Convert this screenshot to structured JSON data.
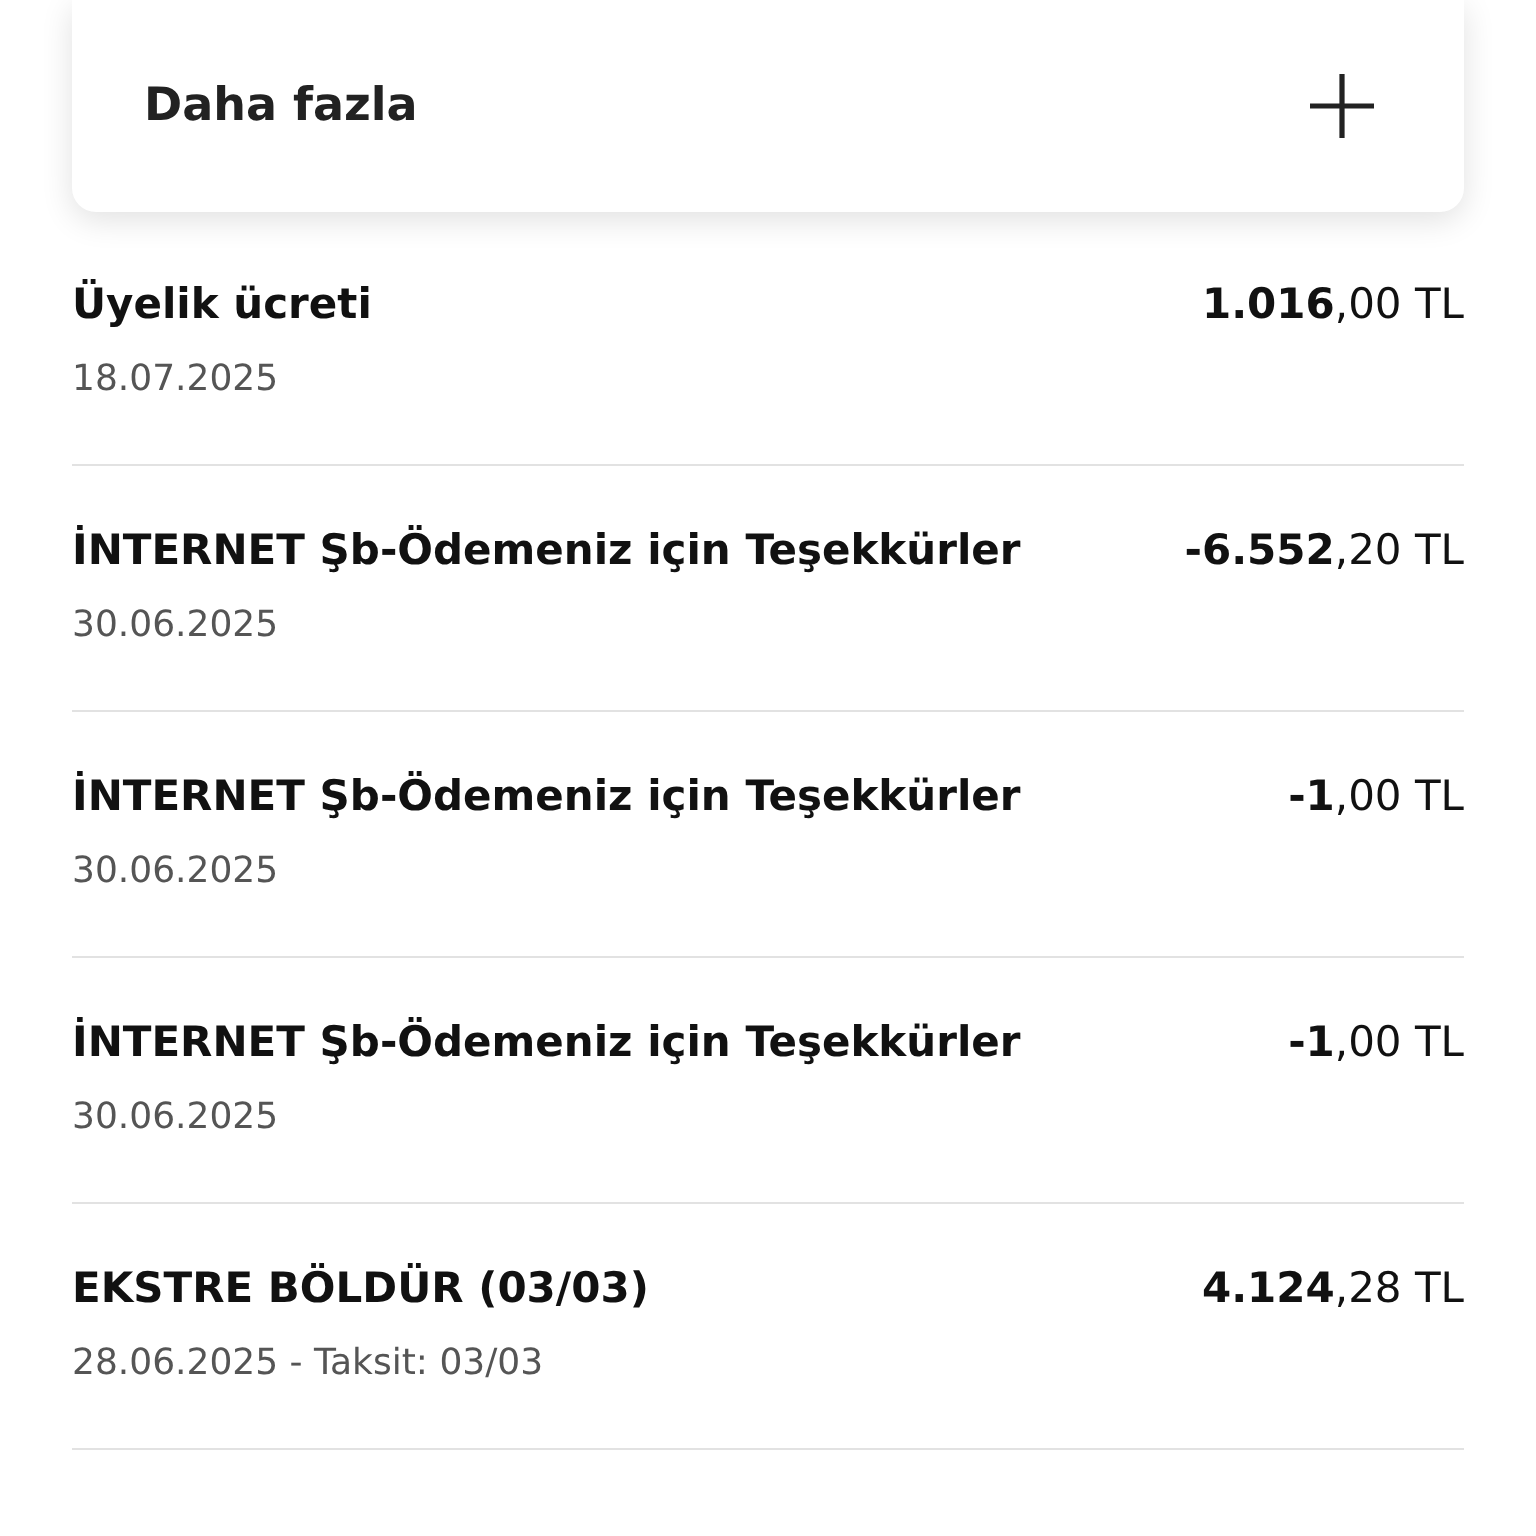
{
  "more_card": {
    "label": "Daha fazla"
  },
  "transactions": [
    {
      "title": "Üyelik ücreti",
      "date": "18.07.2025",
      "amount": "**1.016**,00 TL"
    },
    {
      "title": "İNTERNET Şb-Ödemeniz için Teşekkürler",
      "date": "30.06.2025",
      "amount": "**-6.552**,20 TL"
    },
    {
      "title": "İNTERNET Şb-Ödemeniz için Teşekkürler",
      "date": "30.06.2025",
      "amount": "**-1**,00 TL"
    },
    {
      "title": "İNTERNET Şb-Ödemeniz için Teşekkürler",
      "date": "30.06.2025",
      "amount": "**-1**,00 TL"
    },
    {
      "title": "EKSTRE BÖLDÜR (03/03)",
      "date": "28.06.2025 - Taksit: 03/03",
      "amount": "**4.124**,28 TL"
    }
  ]
}
